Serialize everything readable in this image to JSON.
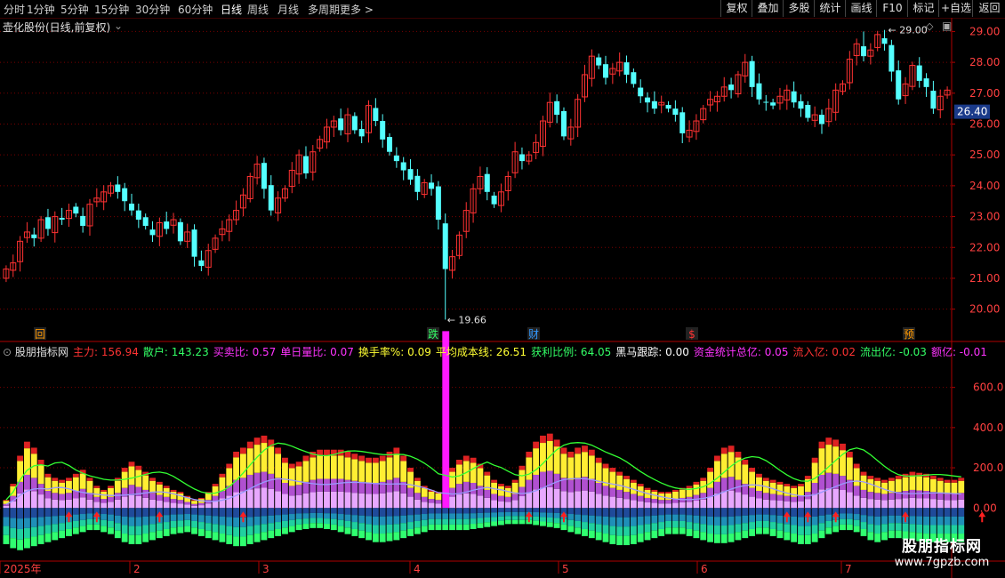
{
  "topbar": {
    "periods": [
      "分时",
      "1分钟",
      "5分钟",
      "15分钟",
      "30分钟",
      "60分钟",
      "日线",
      "周线",
      "月线",
      "多周期",
      "更多 >"
    ],
    "active_period": "日线",
    "buttons": [
      "复权",
      "叠加",
      "多股",
      "统计",
      "画线",
      "F10",
      "标记",
      "+自选",
      "返回"
    ]
  },
  "main_panel": {
    "title": "壶化股份(日线,前复权)",
    "price_axis": [
      "29.00",
      "28.00",
      "27.00",
      "26.00",
      "25.00",
      "24.00",
      "23.00",
      "22.00",
      "21.00",
      "20.00"
    ],
    "current_price": "26.40",
    "high_label": "29.00",
    "low_label": "19.66",
    "markers": [
      {
        "text": "回",
        "color": "#ff9900"
      },
      {
        "text": "跌",
        "color": "#33ff66"
      },
      {
        "text": "财",
        "color": "#3399ff"
      },
      {
        "text": "$",
        "color": "#ff3333"
      },
      {
        "text": "预",
        "color": "#ff9900"
      }
    ]
  },
  "indicator_panel": {
    "title": "股朋指标网",
    "items": [
      {
        "label": "主力: 156.94",
        "color": "#ff3333"
      },
      {
        "label": "散户: 143.23",
        "color": "#33ff66"
      },
      {
        "label": "买卖比: 0.57",
        "color": "#ff33ff"
      },
      {
        "label": "单日量比: 0.07",
        "color": "#ff33ff"
      },
      {
        "label": "换手率%: 0.09",
        "color": "#ffff33"
      },
      {
        "label": "平均成本线: 26.51",
        "color": "#ffff33"
      },
      {
        "label": "获利比例: 64.05",
        "color": "#33ff66"
      },
      {
        "label": "黑马跟踪: 0.00",
        "color": "#ffffff"
      },
      {
        "label": "资金统计总亿: 0.05",
        "color": "#ff33ff"
      },
      {
        "label": "流入亿: 0.02",
        "color": "#ff3333"
      },
      {
        "label": "流出亿: -0.03",
        "color": "#33ff66"
      },
      {
        "label": "额亿: -0.01",
        "color": "#ff33ff"
      }
    ],
    "axis": [
      "600.0",
      "400.0",
      "200.0",
      "0.00"
    ]
  },
  "date_axis": [
    "2025年",
    "2",
    "3",
    "4",
    "5",
    "6",
    "7"
  ],
  "watermark": {
    "title": "股朋指标网",
    "url": "www.7gpzb.com"
  },
  "chart_data": {
    "type": "candlestick",
    "price_ylim": [
      19.5,
      29.3
    ],
    "close": [
      21.3,
      21.5,
      22.2,
      22.5,
      22.3,
      22.9,
      22.6,
      23.0,
      22.9,
      23.2,
      23.1,
      22.7,
      23.4,
      23.6,
      23.8,
      24.0,
      23.8,
      23.5,
      23.2,
      22.9,
      22.7,
      22.4,
      22.8,
      22.6,
      22.9,
      22.2,
      22.5,
      21.7,
      21.4,
      21.9,
      22.3,
      22.6,
      22.9,
      23.2,
      23.7,
      24.3,
      24.7,
      23.9,
      23.2,
      23.6,
      23.9,
      24.5,
      25.0,
      24.4,
      25.1,
      25.5,
      25.9,
      26.1,
      25.8,
      26.3,
      25.8,
      25.6,
      26.6,
      26.1,
      25.5,
      25.1,
      24.8,
      24.5,
      24.2,
      23.8,
      24.1,
      23.9,
      22.9,
      21.3,
      21.7,
      22.4,
      23.2,
      23.9,
      24.3,
      23.8,
      23.4,
      23.8,
      24.3,
      25.1,
      24.8,
      25.0,
      25.4,
      26.1,
      26.7,
      26.3,
      25.6,
      25.9,
      26.8,
      27.6,
      28.2,
      27.9,
      27.5,
      27.8,
      28.0,
      27.6,
      27.3,
      26.9,
      26.7,
      26.5,
      26.7,
      26.5,
      26.3,
      25.7,
      25.8,
      26.1,
      26.5,
      26.8,
      26.9,
      27.2,
      27.1,
      27.6,
      28.0,
      27.2,
      26.8,
      26.7,
      26.6,
      26.9,
      27.1,
      26.7,
      26.5,
      26.2,
      26.3,
      26.0,
      26.5,
      27.1,
      27.3,
      28.1,
      28.6,
      28.2,
      28.4,
      28.9,
      28.6,
      27.7,
      26.8,
      27.3,
      27.9,
      27.4,
      27.2,
      26.5,
      26.9,
      27.1
    ],
    "wave_ylim": [
      -260,
      780
    ],
    "volume_wave": [
      40,
      120,
      260,
      330,
      300,
      240,
      170,
      150,
      140,
      150,
      170,
      190,
      150,
      110,
      90,
      110,
      150,
      200,
      230,
      210,
      180,
      150,
      130,
      110,
      90,
      80,
      60,
      40,
      50,
      80,
      120,
      170,
      220,
      280,
      300,
      330,
      350,
      360,
      340,
      300,
      250,
      220,
      230,
      260,
      280,
      290,
      290,
      290,
      290,
      280,
      270,
      260,
      250,
      250,
      260,
      280,
      300,
      260,
      200,
      150,
      110,
      90,
      80,
      880,
      200,
      240,
      260,
      250,
      220,
      180,
      140,
      120,
      110,
      140,
      210,
      280,
      330,
      360,
      370,
      340,
      300,
      280,
      300,
      310,
      290,
      250,
      220,
      200,
      180,
      160,
      140,
      120,
      100,
      90,
      80,
      80,
      90,
      100,
      110,
      130,
      150,
      200,
      260,
      300,
      310,
      280,
      240,
      200,
      170,
      150,
      140,
      130,
      120,
      110,
      120,
      160,
      250,
      330,
      350,
      340,
      320,
      280,
      220,
      180,
      160,
      150,
      140,
      150,
      160,
      170,
      180,
      175,
      170,
      160,
      150,
      140,
      140,
      150
    ],
    "outflow_wave": [
      -180,
      -200,
      -210,
      -200,
      -190,
      -180,
      -170,
      -160,
      -150,
      -140,
      -130,
      -120,
      -110,
      -110,
      -120,
      -130,
      -150,
      -170,
      -180,
      -180,
      -170,
      -160,
      -150,
      -140,
      -130,
      -125,
      -120,
      -130,
      -140,
      -150,
      -160,
      -170,
      -180,
      -190,
      -190,
      -180,
      -170,
      -160,
      -150,
      -140,
      -130,
      -120,
      -110,
      -105,
      -100,
      -100,
      -105,
      -110,
      -120,
      -130,
      -140,
      -150,
      -160,
      -170,
      -170,
      -165,
      -160,
      -150,
      -140,
      -130,
      -120,
      -110,
      -110,
      -110,
      -110,
      -110,
      -110,
      -105,
      -100,
      -95,
      -90,
      -85,
      -80,
      -80,
      -80,
      -80,
      -85,
      -90,
      -95,
      -100,
      -110,
      -120,
      -130,
      -140,
      -150,
      -160,
      -170,
      -180,
      -185,
      -185,
      -180,
      -170,
      -160,
      -150,
      -140,
      -130,
      -130,
      -130,
      -140,
      -150,
      -160,
      -170,
      -175,
      -175,
      -170,
      -160,
      -150,
      -140,
      -130,
      -130,
      -140,
      -150,
      -160,
      -170,
      -180,
      -180,
      -170,
      -150,
      -130,
      -120,
      -110,
      -110,
      -120,
      -140,
      -160,
      -170,
      -160,
      -150,
      -150,
      -155,
      -160,
      -165,
      -170,
      -170,
      -170,
      -170,
      -170,
      -170,
      -170
    ]
  }
}
